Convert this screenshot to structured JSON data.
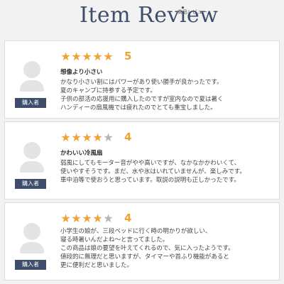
{
  "header": {
    "title": "Item Review",
    "subtitle": "商品レビュー"
  },
  "colors": {
    "star": "#f0a232",
    "star_empty": "#b4b4b4",
    "badge": "#3e4d6b",
    "title": "#3e4d6b"
  },
  "reviews": [
    {
      "rating": 5,
      "score": "5",
      "badge": "購入者",
      "title": "想像より小さい",
      "lines": [
        "かなり小さい割にはパワーがあり使い勝手が良かったです。",
        "夏のキャンプに持参する予定です。",
        "子供の部活の応援用に購入したのですが室内なので夏は暑く",
        "ハンディーの扇風機では疲れたのでとても重宝しました。"
      ]
    },
    {
      "rating": 4,
      "score": "4",
      "badge": "購入者",
      "title": "かわいい冷風扇",
      "lines": [
        "弱風にしてもモーター音がやや高いですが、なかなかかわいくて、",
        "使いやすそうです。まだ、水や氷はいれていませんが、楽しみです。",
        "車中泊等で使おうと思っています。取説の説明も正しかったです。"
      ]
    },
    {
      "rating": 4,
      "score": "4",
      "badge": "購入者",
      "title": "",
      "lines": [
        "小学生の娘が、三段ベッドに行く時の明かりが欲しい、",
        "寝る時暑いんだよね〜と言ってました。",
        "この商品は娘の要望を叶えてくれるので、気に入ったようです。",
        "値段的に無理だと思いますが、タイマーや首ふり機能があると",
        "更に便利だと思いました。"
      ]
    }
  ]
}
